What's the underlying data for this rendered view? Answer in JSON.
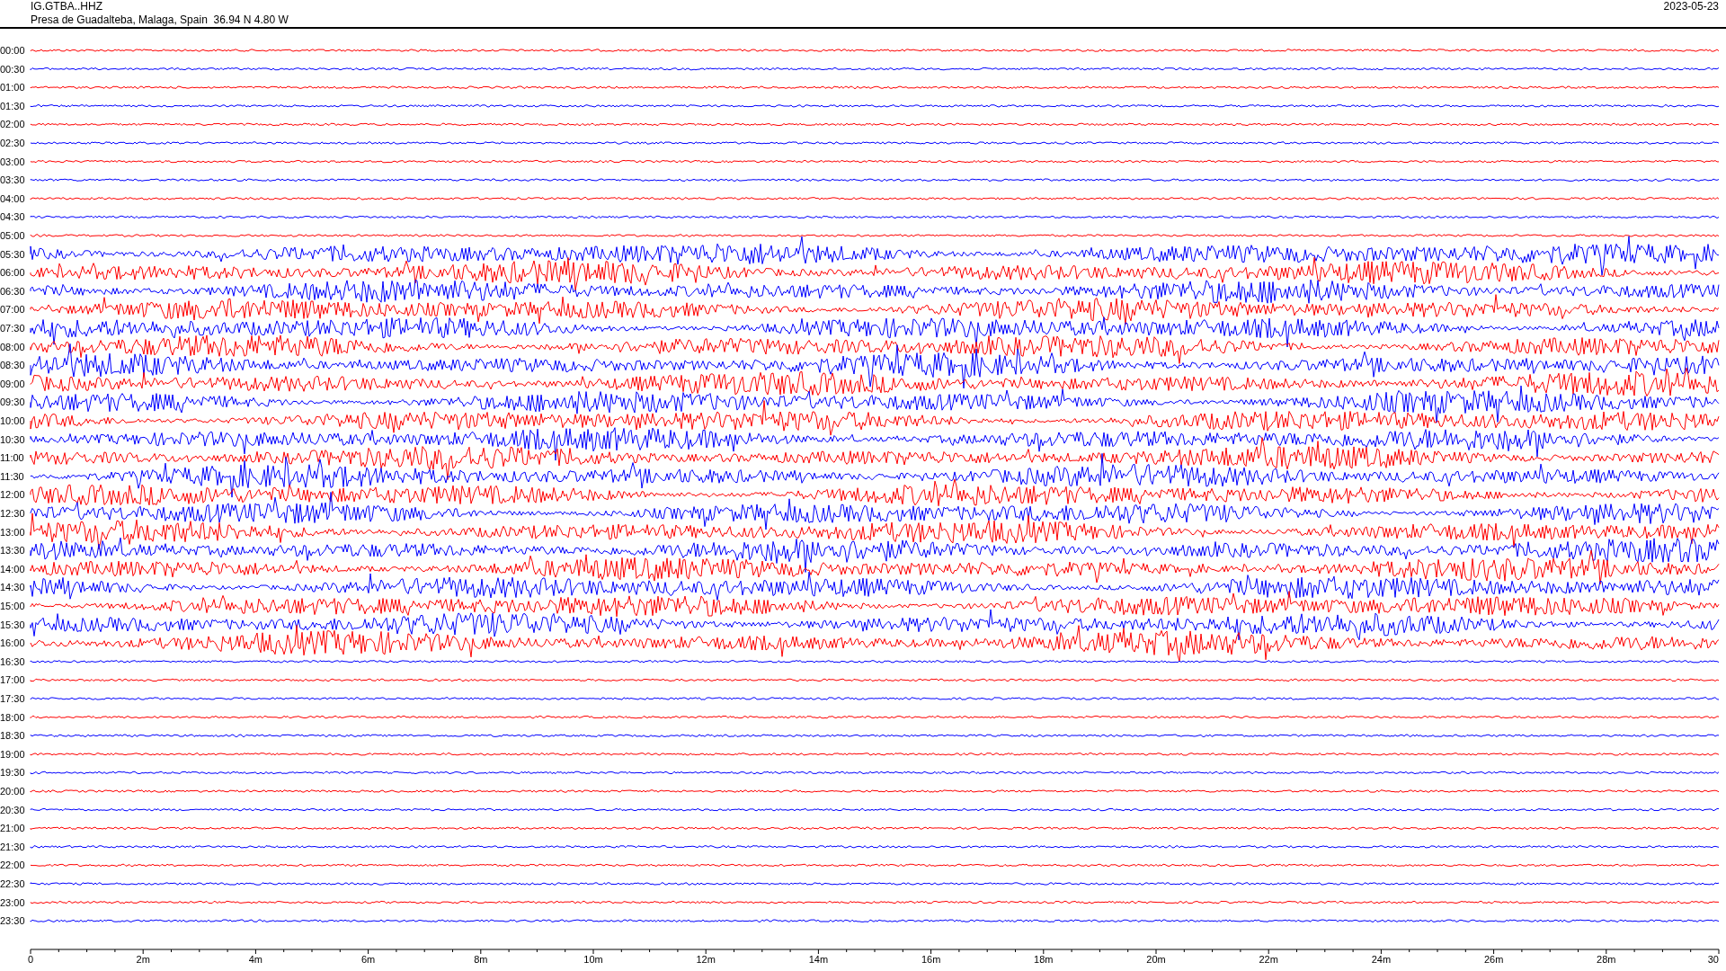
{
  "header": {
    "station": "IG.GTBA..HHZ",
    "location": "Presa de Guadalteba, Malaga, Spain  36.94 N 4.80 W",
    "date": "2023-05-23"
  },
  "rows": [
    {
      "time": "00:00",
      "color": "#ff0000"
    },
    {
      "time": "00:30",
      "color": "#0000ff"
    },
    {
      "time": "01:00",
      "color": "#ff0000"
    },
    {
      "time": "01:30",
      "color": "#0000ff"
    },
    {
      "time": "02:00",
      "color": "#ff0000"
    },
    {
      "time": "02:30",
      "color": "#0000ff"
    },
    {
      "time": "03:00",
      "color": "#ff0000"
    },
    {
      "time": "03:30",
      "color": "#0000ff"
    },
    {
      "time": "04:00",
      "color": "#ff0000"
    },
    {
      "time": "04:30",
      "color": "#0000ff"
    },
    {
      "time": "05:00",
      "color": "#ff0000"
    },
    {
      "time": "05:30",
      "color": "#0000ff"
    },
    {
      "time": "06:00",
      "color": "#ff0000"
    },
    {
      "time": "06:30",
      "color": "#0000ff"
    },
    {
      "time": "07:00",
      "color": "#ff0000"
    },
    {
      "time": "07:30",
      "color": "#0000ff"
    },
    {
      "time": "08:00",
      "color": "#ff0000"
    },
    {
      "time": "08:30",
      "color": "#0000ff"
    },
    {
      "time": "09:00",
      "color": "#ff0000"
    },
    {
      "time": "09:30",
      "color": "#0000ff"
    },
    {
      "time": "10:00",
      "color": "#ff0000"
    },
    {
      "time": "10:30",
      "color": "#0000ff"
    },
    {
      "time": "11:00",
      "color": "#ff0000"
    },
    {
      "time": "11:30",
      "color": "#0000ff"
    },
    {
      "time": "12:00",
      "color": "#ff0000"
    },
    {
      "time": "12:30",
      "color": "#0000ff"
    },
    {
      "time": "13:00",
      "color": "#ff0000"
    },
    {
      "time": "13:30",
      "color": "#0000ff"
    },
    {
      "time": "14:00",
      "color": "#ff0000"
    },
    {
      "time": "14:30",
      "color": "#0000ff"
    },
    {
      "time": "15:00",
      "color": "#ff0000"
    },
    {
      "time": "15:30",
      "color": "#0000ff"
    },
    {
      "time": "16:00",
      "color": "#ff0000"
    },
    {
      "time": "16:30",
      "color": "#0000ff"
    },
    {
      "time": "17:00",
      "color": "#ff0000"
    },
    {
      "time": "17:30",
      "color": "#0000ff"
    },
    {
      "time": "18:00",
      "color": "#ff0000"
    },
    {
      "time": "18:30",
      "color": "#0000ff"
    },
    {
      "time": "19:00",
      "color": "#ff0000"
    },
    {
      "time": "19:30",
      "color": "#0000ff"
    },
    {
      "time": "20:00",
      "color": "#ff0000"
    },
    {
      "time": "20:30",
      "color": "#0000ff"
    },
    {
      "time": "21:00",
      "color": "#ff0000"
    },
    {
      "time": "21:30",
      "color": "#0000ff"
    },
    {
      "time": "22:00",
      "color": "#ff0000"
    },
    {
      "time": "22:30",
      "color": "#0000ff"
    },
    {
      "time": "23:00",
      "color": "#ff0000"
    },
    {
      "time": "23:30",
      "color": "#0000ff"
    }
  ],
  "x_axis": {
    "labels": [
      "0",
      "2m",
      "4m",
      "6m",
      "8m",
      "10m",
      "12m",
      "14m",
      "16m",
      "18m",
      "20m",
      "22m",
      "24m",
      "26m",
      "28m",
      "30"
    ]
  }
}
